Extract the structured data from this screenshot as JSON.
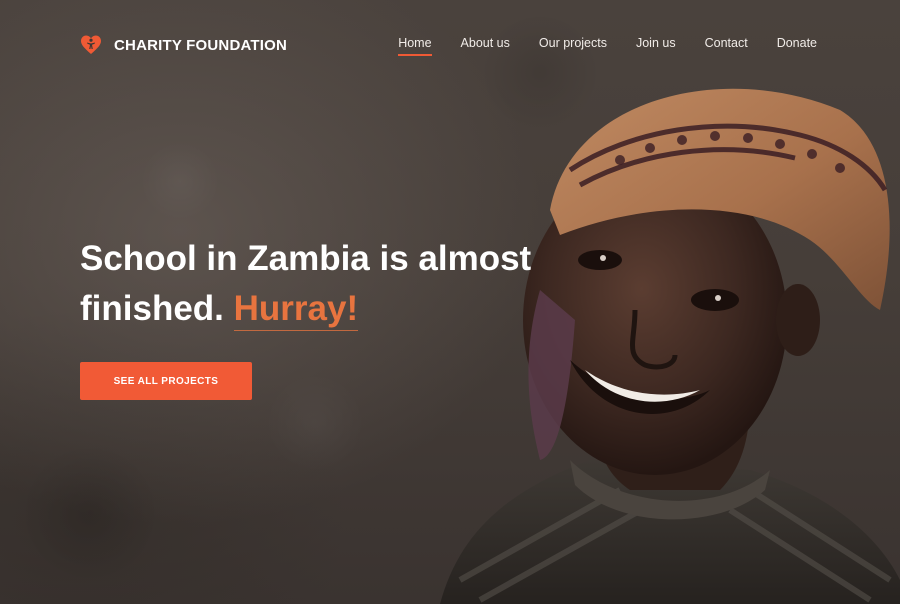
{
  "brand": {
    "name": "CHARITY FOUNDATION",
    "icon": "heart-person-icon",
    "color": "#f05a35"
  },
  "nav": {
    "items": [
      {
        "label": "Home",
        "active": true
      },
      {
        "label": "About us",
        "active": false
      },
      {
        "label": "Our projects",
        "active": false
      },
      {
        "label": "Join us",
        "active": false
      },
      {
        "label": "Contact",
        "active": false
      },
      {
        "label": "Donate",
        "active": false
      }
    ]
  },
  "hero": {
    "headline_line1": "School in Zambia is almost",
    "headline_line2": "finished.",
    "headline_accent": "Hurray!",
    "cta_label": "SEE ALL PROJECTS",
    "image": "smiling-girl-with-headscarf-photo"
  },
  "colors": {
    "accent": "#f15a36",
    "accent_text": "#e8743f",
    "background": "#463e39",
    "text": "#ffffff"
  }
}
